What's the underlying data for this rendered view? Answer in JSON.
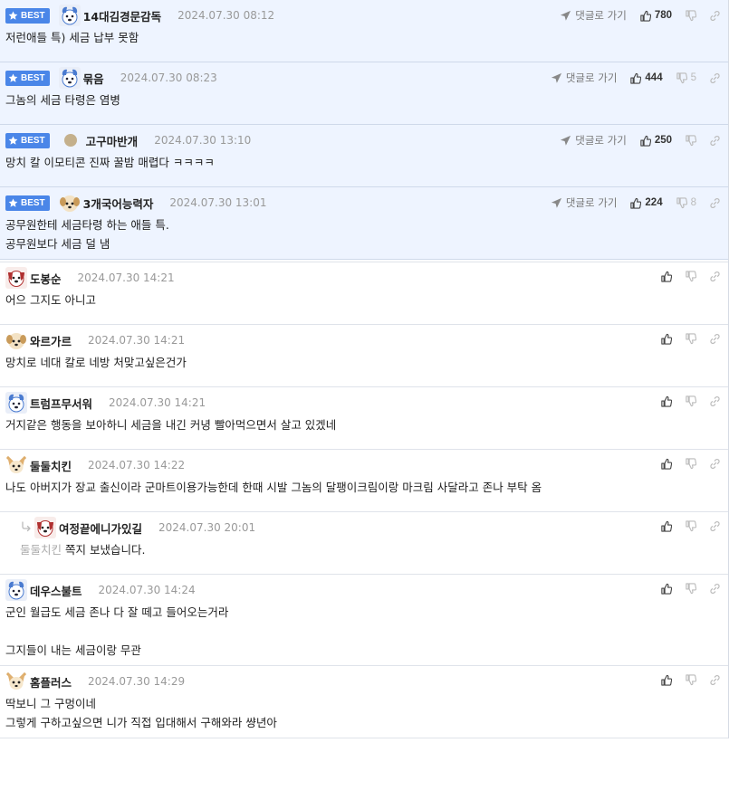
{
  "ui": {
    "best_label": "BEST",
    "goto_reply_label": "댓글로 가기"
  },
  "best_comments": [
    {
      "nick": "14대김경문감독",
      "date": "2024.07.30 08:12",
      "body": "저런애들 특) 세금 납부 못함",
      "likes": "780",
      "dislikes": "",
      "avatar": "blue-dog"
    },
    {
      "nick": "묶음",
      "date": "2024.07.30 08:23",
      "body": "그놈의 세금 타령은 염병",
      "likes": "444",
      "dislikes": "5",
      "avatar": "blue-dog"
    },
    {
      "nick": "고구마반개",
      "date": "2024.07.30 13:10",
      "body": "망치 칼 이모티콘 진짜 꿀밤 매렵다 ㅋㅋㅋㅋ",
      "likes": "250",
      "dislikes": "",
      "avatar": "dot"
    },
    {
      "nick": "3개국어능력자",
      "date": "2024.07.30 13:01",
      "body": "공무원한테 세금타령 하는 애들 특.\n공무원보다 세금 덜 냄",
      "likes": "224",
      "dislikes": "8",
      "avatar": "puppy"
    }
  ],
  "comments": [
    {
      "nick": "도봉순",
      "date": "2024.07.30 14:21",
      "body": "어으 그지도 아니고",
      "avatar": "red-dog"
    },
    {
      "nick": "와르가르",
      "date": "2024.07.30 14:21",
      "body": "망치로 네대 칼로 네방 처맞고싶은건가",
      "avatar": "puppy"
    },
    {
      "nick": "트럼프무서워",
      "date": "2024.07.30 14:21",
      "body": "거지같은 행동을 보아하니 세금을 내긴 커녕 빨아먹으면서 살고 있겠네",
      "avatar": "blue-dog"
    },
    {
      "nick": "둘둘치킨",
      "date": "2024.07.30 14:22",
      "body": "나도 아버지가 장교 출신이라 군마트이용가능한데 한때 시발 그놈의 달팽이크림이랑 마크림 사달라고 존나 부탁 옴",
      "avatar": "fox"
    },
    {
      "nick": "여정끝에니가있길",
      "date": "2024.07.30 20:01",
      "mention": "둘둘치킨",
      "body": "쪽지 보냈습니다.",
      "avatar": "red-dog",
      "reply": true
    },
    {
      "nick": "데우스불트",
      "date": "2024.07.30 14:24",
      "body": "군인 월급도 세금 존나 다 잘 떼고 들어오는거라\n\n그지들이 내는 세금이랑 무관",
      "avatar": "blue-dog"
    },
    {
      "nick": "홈플러스",
      "date": "2024.07.30 14:29",
      "body": "딱보니 그 구멍이네\n그렇게 구하고싶으면 니가 직접 입대해서 구해와라 썅년아",
      "avatar": "fox"
    }
  ],
  "colors": {
    "best_bg": "#eef4ff",
    "badge": "#4a86e8",
    "date": "#999999",
    "border": "#dfe3ea"
  }
}
